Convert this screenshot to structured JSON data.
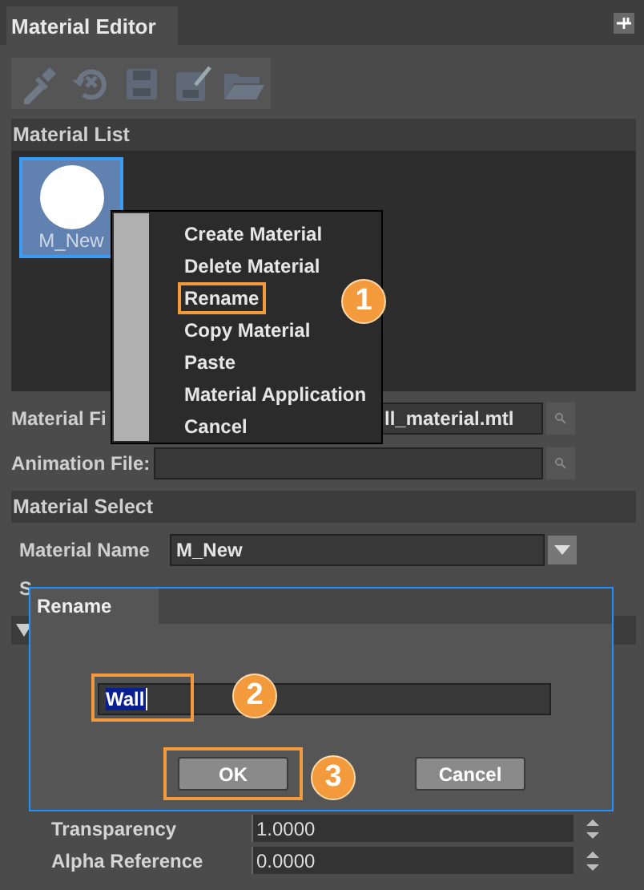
{
  "panel": {
    "title": "Material Editor"
  },
  "material_list": {
    "header": "Material List",
    "items": [
      {
        "label": "M_New",
        "selected": true
      }
    ]
  },
  "context_menu": {
    "items": [
      {
        "label": "Create Material"
      },
      {
        "label": "Delete Material"
      },
      {
        "label": "Rename",
        "callout": "1"
      },
      {
        "label": "Copy Material"
      },
      {
        "label": "Paste"
      },
      {
        "label": "Material Application"
      },
      {
        "label": "Cancel"
      }
    ]
  },
  "file_fields": [
    {
      "label": "Material Fi",
      "value": "ll_material.mtl"
    },
    {
      "label": "Animation File:"
    }
  ],
  "material_select": {
    "header": "Material Select",
    "name_label": "Material Name",
    "name_value": "M_New",
    "cut_label": "S"
  },
  "dialog": {
    "title": "Rename",
    "input": {
      "value": "Wall",
      "selected_text": true,
      "callout": "2"
    },
    "buttons": [
      {
        "label": "OK",
        "callout": "3"
      },
      {
        "label": "Cancel"
      }
    ]
  },
  "properties": [
    {
      "label": "Transparency",
      "value": "1.0000"
    },
    {
      "label": "Alpha Reference",
      "value": "0.0000"
    }
  ]
}
